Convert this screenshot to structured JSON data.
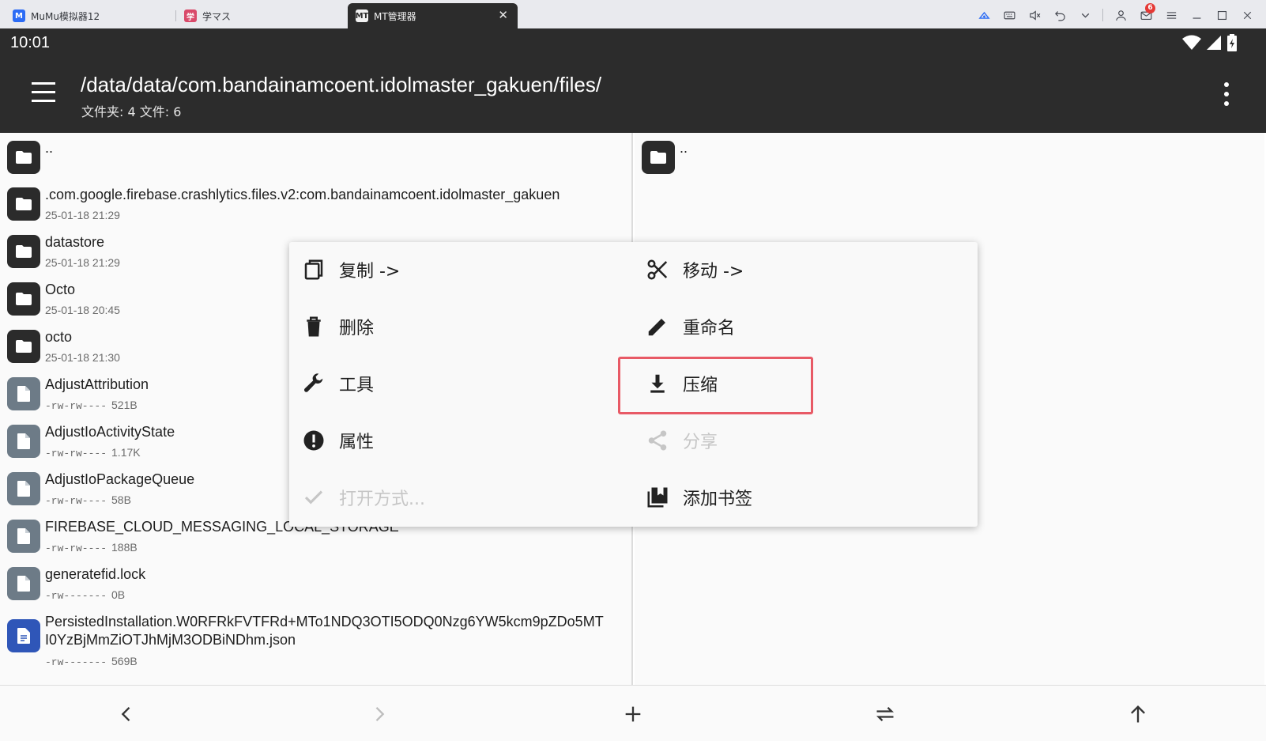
{
  "window": {
    "tabs": [
      {
        "label": "MuMu模拟器12",
        "icon": "mumu-logo-icon"
      },
      {
        "label": "学マス",
        "icon": "game-icon"
      },
      {
        "label": "MT管理器",
        "icon": "mt-manager-icon",
        "active": true
      }
    ],
    "mail_badge": "6",
    "toolbar_icons": [
      "controller-icon",
      "keyboard-icon",
      "volume-mute-icon",
      "undo-icon",
      "chevron-down-icon",
      "user-icon",
      "mail-icon",
      "hamburger-icon",
      "minimize-icon",
      "maximize-icon",
      "close-icon"
    ]
  },
  "statusbar": {
    "time": "10:01"
  },
  "appbar": {
    "path": "/data/data/com.bandainamcoent.idolmaster_gakuen/files/",
    "summary": "文件夹: 4  文件: 6"
  },
  "left_pane": {
    "items": [
      {
        "name": "..",
        "type": "folder",
        "meta": ""
      },
      {
        "name": ".com.google.firebase.crashlytics.files.v2:com.bandainamcoent.idolmaster_gakuen",
        "type": "folder",
        "meta": "25-01-18 21:29"
      },
      {
        "name": "datastore",
        "type": "folder",
        "meta": "25-01-18 21:29"
      },
      {
        "name": "Octo",
        "type": "folder",
        "meta": "25-01-18 20:45"
      },
      {
        "name": "octo",
        "type": "folder",
        "meta": "25-01-18 21:30"
      },
      {
        "name": "AdjustAttribution",
        "type": "file",
        "perm": "-rw-rw----",
        "size": "521B"
      },
      {
        "name": "AdjustIoActivityState",
        "type": "file",
        "perm": "-rw-rw----",
        "size": "1.17K"
      },
      {
        "name": "AdjustIoPackageQueue",
        "type": "file",
        "perm": "-rw-rw----",
        "size": "58B"
      },
      {
        "name": "FIREBASE_CLOUD_MESSAGING_LOCAL_STORAGE",
        "type": "file",
        "perm": "-rw-rw----",
        "size": "188B"
      },
      {
        "name": "generatefid.lock",
        "type": "file",
        "perm": "-rw-------",
        "size": "0B"
      },
      {
        "name": "PersistedInstallation.W0RFRkFVTFRd+MTo1NDQ3OTI5ODQ0Nzg6YW5kcm9pZDo5MT",
        "name2": "I0YzBjMmZiOTJhMjM3ODBiNDhm.json",
        "type": "doc",
        "perm": "-rw-------",
        "size": "569B"
      }
    ]
  },
  "right_pane": {
    "items": [
      {
        "name": "..",
        "type": "folder"
      }
    ]
  },
  "context_menu": {
    "copy": "复制 ->",
    "move": "移动 ->",
    "delete": "删除",
    "rename": "重命名",
    "tools": "工具",
    "compress": "压缩",
    "properties": "属性",
    "share": "分享",
    "open_with": "打开方式...",
    "bookmark": "添加书签"
  },
  "colors": {
    "appbar": "#2c2c2c",
    "folder_icon": "#2b2b2b",
    "file_icon": "#6d7b87",
    "doc_icon": "#2f56b8",
    "highlight": "#e85a66",
    "disabled": "#c6c6c6"
  }
}
